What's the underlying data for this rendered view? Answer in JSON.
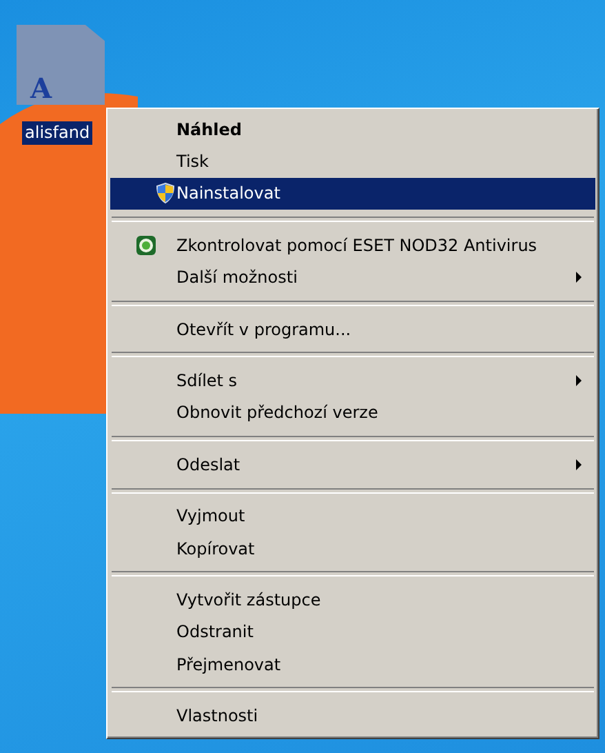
{
  "desktop_icon": {
    "label": "alisfand",
    "glyph": "A",
    "selected": true
  },
  "context_menu": {
    "items": [
      {
        "kind": "item",
        "label": "Náhled",
        "default": true,
        "selected": false,
        "submenu": false
      },
      {
        "kind": "item",
        "label": "Tisk",
        "default": false,
        "selected": false,
        "submenu": false
      },
      {
        "kind": "shield",
        "label": "Nainstalovat",
        "default": false,
        "selected": true,
        "submenu": false
      },
      {
        "kind": "separator"
      },
      {
        "kind": "scan",
        "label": "Zkontrolovat pomocí ESET NOD32 Antivirus",
        "default": false,
        "selected": false,
        "submenu": false
      },
      {
        "kind": "item",
        "label": "Další možnosti",
        "default": false,
        "selected": false,
        "submenu": true
      },
      {
        "kind": "separator"
      },
      {
        "kind": "item",
        "label": "Otevřít v programu...",
        "default": false,
        "selected": false,
        "submenu": false
      },
      {
        "kind": "separator"
      },
      {
        "kind": "item",
        "label": "Sdílet s",
        "default": false,
        "selected": false,
        "submenu": true
      },
      {
        "kind": "item",
        "label": "Obnovit předchozí verze",
        "default": false,
        "selected": false,
        "submenu": false
      },
      {
        "kind": "separator"
      },
      {
        "kind": "item",
        "label": "Odeslat",
        "default": false,
        "selected": false,
        "submenu": true
      },
      {
        "kind": "separator"
      },
      {
        "kind": "item",
        "label": "Vyjmout",
        "default": false,
        "selected": false,
        "submenu": false
      },
      {
        "kind": "item",
        "label": "Kopírovat",
        "default": false,
        "selected": false,
        "submenu": false
      },
      {
        "kind": "separator"
      },
      {
        "kind": "item",
        "label": "Vytvořit zástupce",
        "default": false,
        "selected": false,
        "submenu": false
      },
      {
        "kind": "item",
        "label": "Odstranit",
        "default": false,
        "selected": false,
        "submenu": false
      },
      {
        "kind": "item",
        "label": "Přejmenovat",
        "default": false,
        "selected": false,
        "submenu": false
      },
      {
        "kind": "separator"
      },
      {
        "kind": "item",
        "label": "Vlastnosti",
        "default": false,
        "selected": false,
        "submenu": false
      }
    ]
  }
}
